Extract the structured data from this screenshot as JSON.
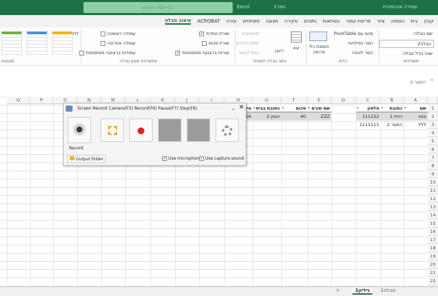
{
  "titlebar": {
    "autosave": "שמירה אוטומטית",
    "file": "ספר1",
    "app": "Excel",
    "search_placeholder": "חיפוש (Alt+Q)"
  },
  "tabs": [
    "קובץ",
    "בית",
    "הוספה",
    "ציור",
    "פריסת עמוד",
    "נוסחאות",
    "נתונים",
    "סקירה",
    "תצוגה",
    "מפתחים",
    "עזרה",
    "ACROBAT",
    "עיצוב טבלה"
  ],
  "active_tab": "עיצוב טבלה",
  "ribbon": {
    "properties": {
      "label": "מאפיינים",
      "table_name_label": "שם טבלה:",
      "table_name_value": "טבלה2",
      "resize": "שנה גודל טבלה"
    },
    "tools": {
      "label": "כלים",
      "pivot": "סכם עם PivotTable",
      "remove_dup": "הסר כפילויות",
      "convert": "המר לטווח",
      "slicer": "הוספת כלי פריסה"
    },
    "external": {
      "label": "נתוני טבלה חיצונית",
      "export": "יצא",
      "refresh": "רענן",
      "properties": "מאפיינים",
      "open_browser": "פתח בדפדפן",
      "unlink": "בטל קישור"
    },
    "style_options": {
      "label": "אפשרויות סגנון טבלה",
      "header_row": "שורת כותרת",
      "total_row": "שורת סכום",
      "banded_rows": "שורות ברצועה מפוספסת",
      "first_col": "עמודה ראשונה",
      "last_col": "עמודה אחרונה",
      "banded_cols": "עמודות ברצועה מפוספסת",
      "filter_button": "לחצן סינון",
      "checked": {
        "header_row": true,
        "total_row": false,
        "banded_rows": true,
        "first_col": false,
        "last_col": false,
        "banded_cols": false,
        "filter_button": true
      }
    },
    "styles": {
      "label": "סגנונות",
      "colors": [
        "#f5b400",
        "#4f8fd8",
        "#70ad47"
      ]
    }
  },
  "formula_bar": {
    "value": "התמר 2"
  },
  "columns": [
    "A",
    "B",
    "C",
    "D",
    "E",
    "F",
    "G",
    "H",
    "I",
    "J",
    "K",
    "L",
    "M",
    "N",
    "O",
    "P",
    "Q"
  ],
  "table1": {
    "headers": [
      "שם",
      "כתובת",
      "טלפון"
    ],
    "rows": [
      [
        "xxx",
        "הזית 1",
        "111222"
      ],
      [
        "YYY",
        "התמר 2",
        "1111111"
      ]
    ]
  },
  "table2": {
    "headers": [
      "שם תורם",
      "סכום",
      "כתובת בבית",
      "טל"
    ],
    "rows": [
      [
        "ZZZ",
        "40",
        "ויצמן 2",
        "56"
      ]
    ]
  },
  "recorder": {
    "title": "Screen Record",
    "menu": "Camera(F5) Record(F6) Pause(F7) Stop(F8)",
    "record_label": "Record",
    "output_folder": "Output folder",
    "use_mic": "Use microphone",
    "use_sound": "Use capture sound",
    "mic_checked": true,
    "sound_checked": true
  },
  "sheets": [
    "גיליון1",
    "טבלה1"
  ],
  "active_sheet": "גיליון1"
}
